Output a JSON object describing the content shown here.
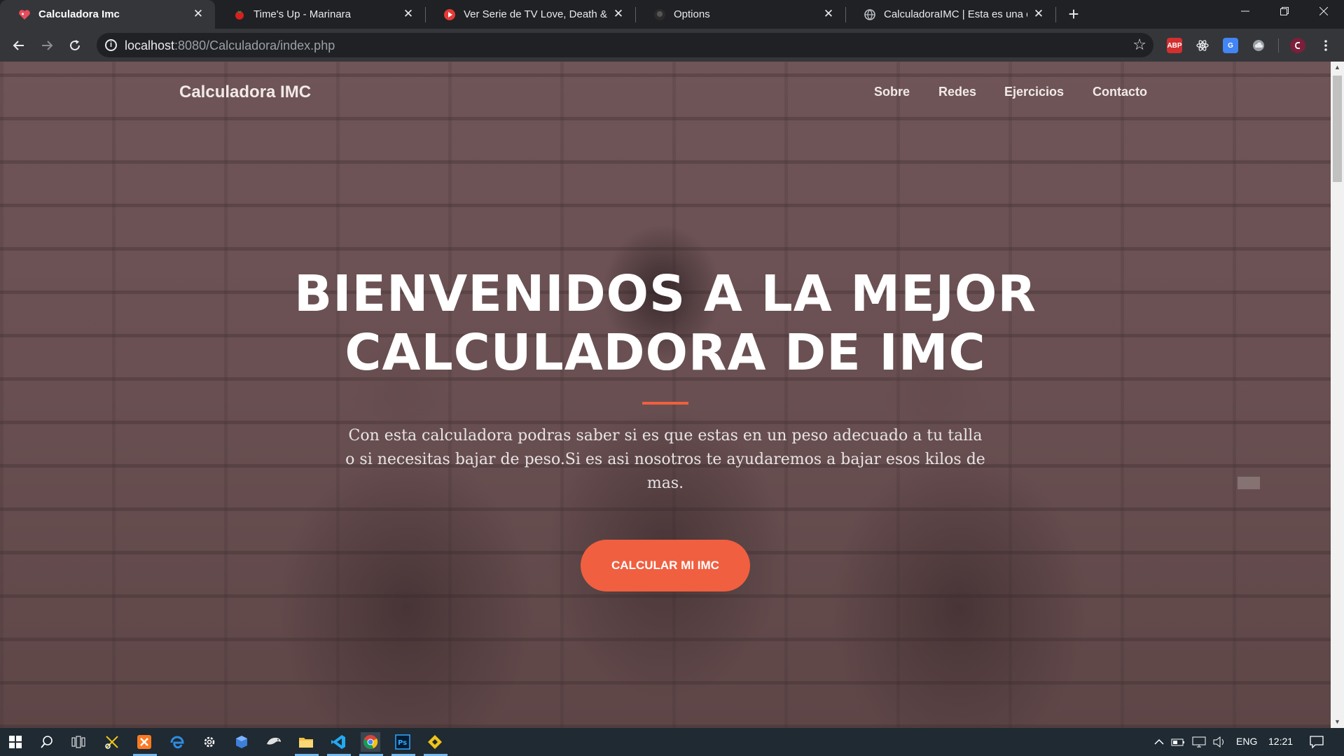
{
  "browser": {
    "tabs": [
      {
        "title": "Calculadora Imc",
        "favicon": "heart-favicon",
        "active": true
      },
      {
        "title": "Time's Up - Marinara",
        "favicon": "tomato-favicon",
        "active": false
      },
      {
        "title": "Ver Serie de TV Love, Death & Ro",
        "favicon": "play-favicon",
        "active": false
      },
      {
        "title": "Options",
        "favicon": "github-favicon",
        "active": false
      },
      {
        "title": "CalculadoraIMC | Esta es una calc",
        "favicon": "globe-favicon",
        "active": false
      }
    ],
    "url_host": "localhost",
    "url_path": ":8080/Calculadora/index.php",
    "extensions": [
      "ABP",
      "react-devtools",
      "translate",
      "cloud",
      "profile"
    ]
  },
  "page": {
    "brand": "Calculadora IMC",
    "nav": [
      "Sobre",
      "Redes",
      "Ejercicios",
      "Contacto"
    ],
    "hero_title_line1": "BIENVENIDOS A LA MEJOR",
    "hero_title_line2": "CALCULADORA DE IMC",
    "hero_text": "Con esta calculadora podras saber si es que estas en un peso adecuado a tu talla o si necesitas bajar de peso.Si es asi nosotros te ayudaremos a bajar esos kilos de mas.",
    "cta_label": "CALCULAR MI IMC",
    "accent_color": "#f05f40"
  },
  "taskbar": {
    "language": "ENG",
    "time": "12:21"
  }
}
